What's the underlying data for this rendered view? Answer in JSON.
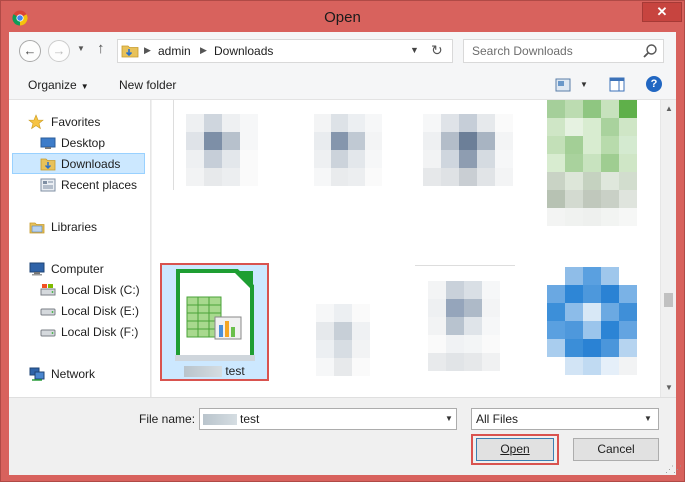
{
  "window": {
    "title": "Open",
    "close_glyph": "✕"
  },
  "nav": {
    "back_glyph": "←",
    "forward_glyph": "→",
    "up_glyph": "↑",
    "breadcrumbs": [
      "admin",
      "Downloads"
    ],
    "search_placeholder": "Search Downloads"
  },
  "toolbar": {
    "organize": "Organize",
    "new_folder": "New folder",
    "help": "?"
  },
  "sidebar": {
    "favorites": "Favorites",
    "desktop": "Desktop",
    "downloads": "Downloads",
    "recent": "Recent places",
    "libraries": "Libraries",
    "computer": "Computer",
    "disk_c": "Local Disk (C:)",
    "disk_e": "Local Disk (E:)",
    "disk_f": "Local Disk (F:)",
    "network": "Network"
  },
  "files": {
    "selected_name": "test"
  },
  "footer": {
    "file_name_label": "File name:",
    "file_name_value": "test",
    "file_type": "All Files",
    "open_label": "Open",
    "cancel_label": "Cancel"
  },
  "colors": {
    "accent_red": "#d9534f",
    "selection": "#cce8ff",
    "calc_green": "#1e9e32"
  }
}
